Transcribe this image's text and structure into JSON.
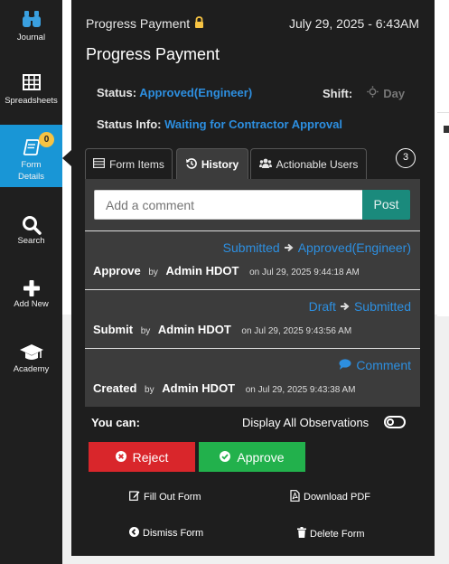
{
  "sidebar": {
    "items": [
      {
        "label": "Journal",
        "icon": "binoculars-icon"
      },
      {
        "label": "Spreadsheets",
        "icon": "grid-icon"
      },
      {
        "label_line1": "Form",
        "label_line2": "Details",
        "icon": "form-icon",
        "badge": "0",
        "active": true
      },
      {
        "label": "Search",
        "icon": "search-icon"
      },
      {
        "label": "Add New",
        "icon": "plus-icon"
      },
      {
        "label": "Academy",
        "icon": "graduation-cap-icon"
      }
    ]
  },
  "header": {
    "form_type": "Progress Payment",
    "datetime": "July 29, 2025 - 6:43AM",
    "title": "Progress Payment",
    "status_label": "Status:",
    "status_value": "Approved(Engineer)",
    "shift_label": "Shift:",
    "shift_value": "Day",
    "status_info_label": "Status Info:",
    "status_info_value": "Waiting for Contractor Approval"
  },
  "tabs": [
    {
      "label": "Form Items",
      "icon": "list-icon"
    },
    {
      "label": "History",
      "icon": "history-icon",
      "active": true
    },
    {
      "label": "Actionable Users",
      "icon": "users-icon"
    }
  ],
  "actionable_count": "3",
  "history": {
    "comment_placeholder": "Add a comment",
    "post_label": "Post",
    "entries": [
      {
        "from": "Submitted",
        "to": "Approved(Engineer)",
        "action": "Approve",
        "by": "by",
        "user": "Admin HDOT",
        "on": "on Jul 29, 2025 9:44:18 AM"
      },
      {
        "from": "Draft",
        "to": "Submitted",
        "action": "Submit",
        "by": "by",
        "user": "Admin HDOT",
        "on": "on Jul 29, 2025 9:43:56 AM"
      },
      {
        "comment_label": "Comment",
        "action": "Created",
        "by": "by",
        "user": "Admin HDOT",
        "on": "on Jul 29, 2025 9:43:38 AM"
      }
    ]
  },
  "actions": {
    "you_can": "You can:",
    "display_all": "Display All Observations",
    "reject": "Reject",
    "approve": "Approve",
    "fill_out": "Fill Out Form",
    "download_pdf": "Download PDF",
    "dismiss": "Dismiss Form",
    "delete": "Delete Form"
  },
  "colors": {
    "accent_blue": "#1996d6",
    "link_blue": "#2d8fe0",
    "reject_red": "#d9262b",
    "approve_green": "#22b14c",
    "post_teal": "#1a8a7c",
    "badge_yellow": "#f6c343"
  }
}
